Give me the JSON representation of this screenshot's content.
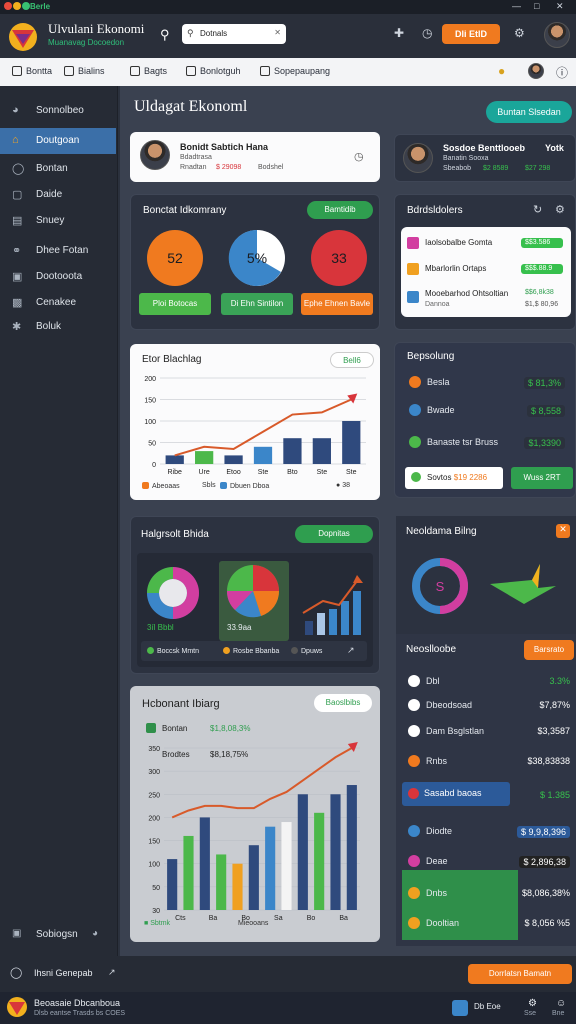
{
  "window": {
    "title": "Berle",
    "controls": [
      "—",
      "□",
      "✕"
    ]
  },
  "header": {
    "app_title": "Ulvulani Ekonomi",
    "app_subtitle": "Muanavag Docoedon",
    "search_placeholder": "Dotnals",
    "cta": "Dli EtlD"
  },
  "toolbar": {
    "items": [
      "Bontta",
      "Bialins",
      "Bagts",
      "Bonlotguh",
      "Sopepaupang"
    ]
  },
  "sidebar": {
    "items": [
      {
        "label": "Sonnolbeo",
        "icon": "gauge-icon"
      },
      {
        "label": "Doutgoan",
        "icon": "home-icon",
        "active": true
      },
      {
        "label": "Bontan",
        "icon": "shield-icon"
      },
      {
        "label": "Daide",
        "icon": "document-icon"
      },
      {
        "label": "Snuey",
        "icon": "chart-icon"
      },
      {
        "label": "Dhee Fotan",
        "icon": "globe-icon"
      },
      {
        "label": "Dootooota",
        "icon": "folder-icon"
      },
      {
        "label": "Cenakee",
        "icon": "car-icon"
      },
      {
        "label": "Boluk",
        "icon": "gear-icon"
      }
    ],
    "footer": "Sobiogsn"
  },
  "main": {
    "page_title": "Uldagat Ekonoml",
    "top_button": "Buntan Slsedan",
    "profile1": {
      "name": "Bonidt Sabtich Hana",
      "line1": "Bdadtrasa",
      "line2_a": "Rnadtan",
      "line2_b": "$ 29098",
      "line2_c": "Bodshel"
    },
    "profile2": {
      "name": "Sosdoe Benttlooeb",
      "value": "Yotk",
      "line1": "Banatin Sooxa",
      "line2_a": "Sbeabob",
      "line2_b": "$2 8589",
      "line2_c": "$27 298"
    },
    "gauges": {
      "title": "Bonctat Idkomrany",
      "pill": "Bamtidib",
      "items": [
        {
          "value": "52",
          "color": "#f07a1f",
          "button": "Ploi Botocas",
          "btn_color": "#4cb84a"
        },
        {
          "value": "5%",
          "color": "#3b86c9",
          "button": "Di Ehn Sintilon",
          "btn_color": "#3aa357"
        },
        {
          "value": "33",
          "color": "#d8353b",
          "button": "Ephe Ehnen Bavle",
          "btn_color": "#f07a1f"
        }
      ]
    },
    "right_list": {
      "title": "Bdrdsldolers",
      "rows": [
        {
          "label": "Iaolsobalbe Gomta",
          "icon_color": "#d23ea0",
          "value": "$$3.586"
        },
        {
          "label": "Mbarlorlin Ortaps",
          "icon_color": "#f0a020",
          "value": "$$$.88.9"
        },
        {
          "label": "Mooebarhod Ohtsoltian",
          "sub": "Dannoa",
          "icon_color": "#3b86c9",
          "value": "$$6,8k38",
          "value2": "$1,$ 80,96"
        }
      ]
    },
    "bar_chart1": {
      "title": "Etor Blachlag",
      "badge": "Bell6",
      "legend": [
        "Abeoaas",
        "Sbls",
        "Dbuen Dboa"
      ],
      "footer": "38"
    },
    "side_list": {
      "title": "Bepsolung",
      "rows": [
        {
          "label": "Besla",
          "value": "$ 81,3%",
          "icon_color": "#f07a1f"
        },
        {
          "label": "Bwade",
          "value": "$ 8,558",
          "icon_color": "#3b86c9"
        },
        {
          "label": "Banaste tsr Bruss",
          "value": "$1,3390",
          "icon_color": "#4cb84a"
        }
      ],
      "btn_white": "Sovtos",
      "btn_white_value": "$19 2286",
      "btn_green": "Wuss 2RT"
    },
    "insights": {
      "title": "Halgrsolt Bhida",
      "pill": "Dopnitas",
      "tile2": "33.9aa",
      "tile1": "3íl Bbbl",
      "legend": [
        "Boccsk Mmtn",
        "Rosbe Bbanba",
        "Dpuws"
      ]
    },
    "ring_panel": {
      "title": "Neoldama Bilng",
      "ring_letter": "S"
    },
    "stats_list": {
      "title": "Neoslloobe",
      "pill": "Barsrato",
      "rows": [
        {
          "label": "Dbl",
          "value": "3.3%"
        },
        {
          "label": "Dbeodsoad",
          "value": "$7,87%"
        },
        {
          "label": "Dam Bsglstlan",
          "value": "$3,3587"
        },
        {
          "label": "Rnbs",
          "value": "$38,83838"
        },
        {
          "label": "Sasabd baoas",
          "value": "$ 1.385",
          "highlight": true
        },
        {
          "label": "Diodte",
          "value": "$ 9,9,8,396"
        },
        {
          "label": "Deae",
          "value": "$ 2,896,38"
        },
        {
          "label": "Dnbs",
          "value": "$8,086,38%"
        },
        {
          "label": "Dooltian",
          "value": "$ 8,056 %5"
        }
      ]
    },
    "bar_chart2": {
      "title": "Hcbonant Ibiarg",
      "pill": "Baoslbibs",
      "legend_a": "Bontan",
      "legend_a_val": "$1,8,08,3%",
      "legend_b": "Brodtes",
      "legend_b_val": "$8,18,75%",
      "xlabel": "Mieooans",
      "footer": "Sbtmk"
    }
  },
  "chart_data": [
    {
      "type": "bar",
      "title": "Etor Blachlag",
      "yticks": [
        "0",
        "50",
        "100",
        "150",
        "200"
      ],
      "ylim": [
        0,
        200
      ],
      "categories": [
        "Ribe",
        "Ure",
        "Etoo",
        "Ste",
        "Bto",
        "Ste",
        "Ste"
      ],
      "series": [
        {
          "values": [
            20,
            30,
            20,
            40,
            60,
            60,
            100
          ]
        }
      ],
      "bar_colors": [
        "#2f4a7d",
        "#4cb84a",
        "#2f4a7d",
        "#3b86c9",
        "#2f4a7d",
        "#2f4a7d",
        "#2f4a7d"
      ],
      "trend": [
        20,
        40,
        35,
        75,
        115,
        120,
        150
      ]
    },
    {
      "type": "bar",
      "title": "Hcbonant Ibiarg",
      "yticks": [
        "30",
        "50",
        "100",
        "150",
        "200",
        "250",
        "300",
        "350"
      ],
      "ylim": [
        0,
        350
      ],
      "categories": [
        "Cts",
        "Ba",
        "Bo",
        "Sa",
        "Bo",
        "Ba"
      ],
      "series": [
        {
          "values": [
            110,
            160,
            200,
            120,
            100,
            140,
            180,
            190,
            250,
            210,
            250,
            270
          ]
        }
      ],
      "bar_colors": [
        "#2f4a7d",
        "#4cb84a",
        "#2f4a7d",
        "#4cb84a",
        "#f0a020",
        "#2f4a7d",
        "#3b86c9",
        "#f4f4f4",
        "#2f4a7d",
        "#4cb84a",
        "#2f4a7d",
        "#2f4a7d"
      ],
      "trend": [
        200,
        215,
        225,
        225,
        220,
        220,
        240,
        255,
        280,
        305,
        330,
        350
      ]
    }
  ]
}
